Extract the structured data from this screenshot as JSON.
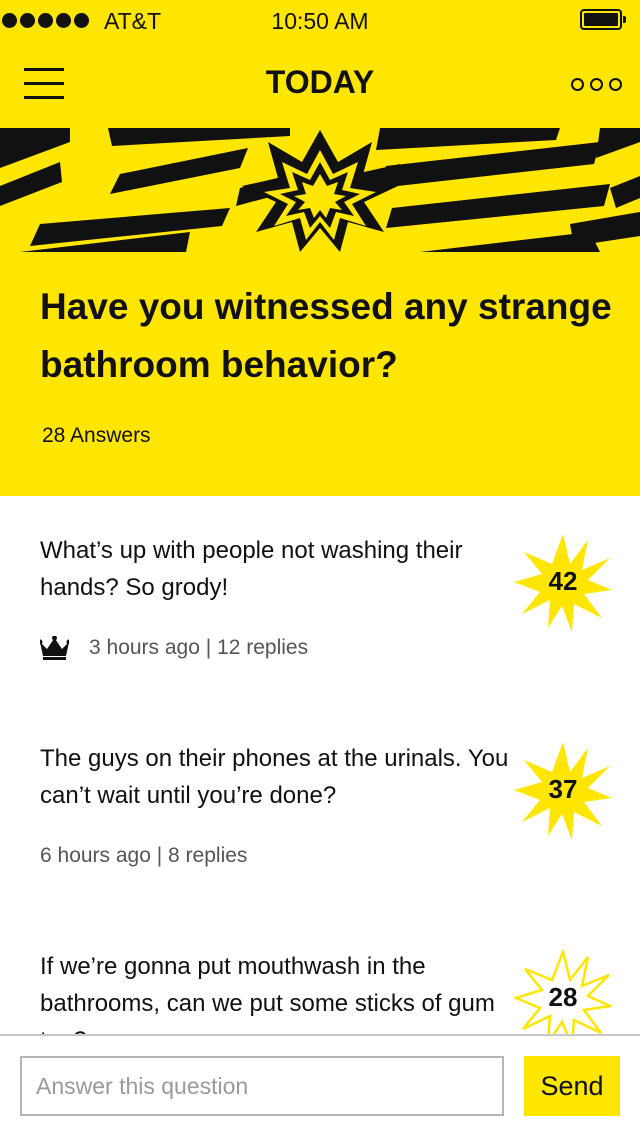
{
  "status_bar": {
    "carrier": "AT&T",
    "time": "10:50 AM"
  },
  "nav": {
    "title": "TODAY",
    "menu_icon": "hamburger-menu-icon",
    "more_icon": "more-dots-icon"
  },
  "question": {
    "title": "Have you witnessed any strange bathroom behavior?",
    "answer_count": "28 Answers"
  },
  "answers": [
    {
      "text": "What’s up with people not washing their hands? So grody!",
      "meta": "3 hours ago | 12 replies",
      "votes": "42",
      "crowned": true
    },
    {
      "text": "The guys on their phones at the urinals. You can’t wait until you’re done?",
      "meta": "6 hours ago | 8 replies",
      "votes": "37",
      "crowned": false
    },
    {
      "text": "If we’re gonna put mouthwash in the bathrooms, can we put some sticks of gum too?",
      "meta": "",
      "votes": "28",
      "crowned": false
    }
  ],
  "composer": {
    "placeholder": "Answer this question",
    "send_label": "Send"
  },
  "colors": {
    "brand_yellow": "#FFE600",
    "text": "#111111",
    "meta_gray": "#555555"
  }
}
